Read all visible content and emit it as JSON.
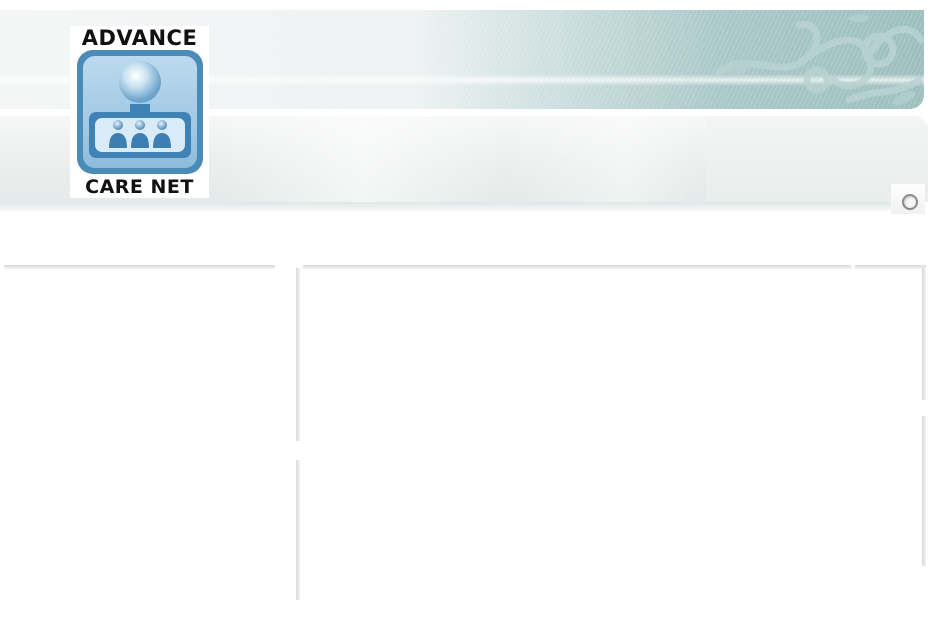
{
  "logo": {
    "top_text": "ADVANCE",
    "bottom_text": "CARE NET",
    "icon": "care-network-people-icon",
    "colors": {
      "frame": "#4a8bb8",
      "fill": "#a9cde6",
      "people": "#3c7fb3"
    }
  },
  "header": {
    "accent_color": "#9cbfbe",
    "radio_icon": "radio-button-icon"
  }
}
